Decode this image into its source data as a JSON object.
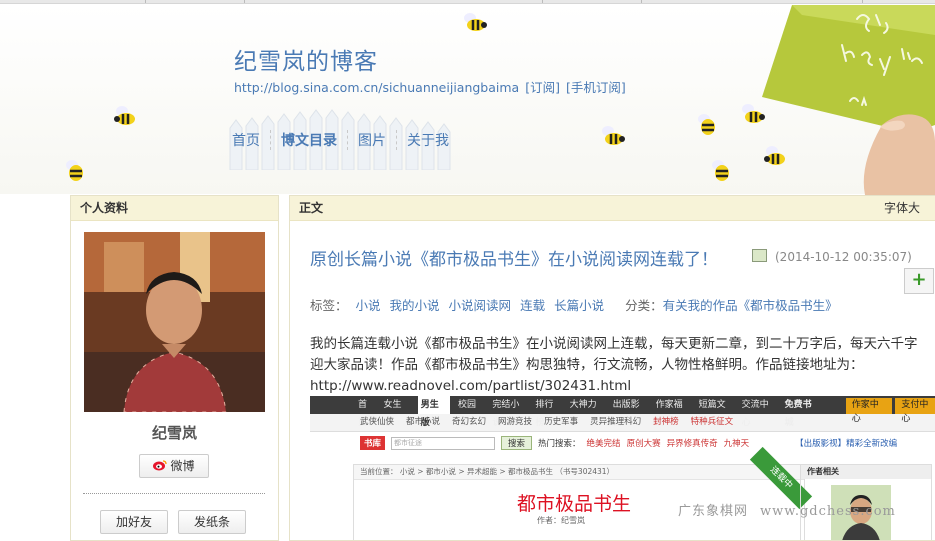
{
  "blog": {
    "title": "纪雪岚的博客",
    "url": "http://blog.sina.com.cn/sichuanneijiangbaima",
    "subscribe": "[订阅]",
    "mobile_subscribe": "[手机订阅]"
  },
  "nav": [
    {
      "label": "首页",
      "active": false
    },
    {
      "label": "博文目录",
      "active": true
    },
    {
      "label": "图片",
      "active": false
    },
    {
      "label": "关于我",
      "active": false
    }
  ],
  "sidebar": {
    "heading": "个人资料",
    "username": "纪雪岚",
    "weibo_label": "微博",
    "add_friend": "加好友",
    "send_note": "发纸条"
  },
  "main": {
    "heading": "正文",
    "font_size_label": "字体大",
    "post_title": "原创长篇小说《都市极品书生》在小说阅读网连载了！",
    "post_date": "(2014-10-12 00:35:07)",
    "plus_label": "+",
    "tags_label": "标签：",
    "tags": [
      "小说",
      "我的小说",
      "小说阅读网",
      "连载",
      "长篇小说"
    ],
    "category_label": "分类：",
    "category": "有关我的作品《都市极品书生》",
    "body_lines": [
      "我的长篇连载小说《都市极品书生》在小说阅读网上连载，每天更新二章，到二十万字后，每天六千字",
      "迎大家品读！作品《都市极品书生》构思独特，行文流畅，人物性格鲜明。作品链接地址为：",
      "http://www.readnovel.com/partlist/302431.html"
    ]
  },
  "embedded": {
    "nav_items": [
      "首页",
      "女生版",
      "男生版",
      "校园版",
      "完结小说",
      "排行榜",
      "大神力作",
      "出版影视",
      "作家福利",
      "短篇文学",
      "交流中心",
      "免费书城"
    ],
    "nav_active": "男生版",
    "nav_buttons": [
      "作家中心",
      "支付中心"
    ],
    "sub_items": [
      "武侠仙侠",
      "都市小说",
      "奇幻玄幻",
      "网游竞技",
      "历史军事",
      "灵异推理科幻",
      "封神榜",
      "特种兵征文"
    ],
    "logo": "书库",
    "search_placeholder": "都市征途",
    "search_button": "搜索",
    "hot_label": "热门搜索：",
    "hot_items": [
      "绝美完结",
      "原创大赛",
      "异界修真传奇",
      "九神天"
    ],
    "right_link": "【出版影视】精彩全新改编",
    "crumb": "当前位置：  小说  >  都市小说  >  异术超能  >  都市极品书生 （书号302431）",
    "book_title": "都市极品书生",
    "author": "作者：纪雪岚",
    "ribbon": "连载中",
    "side_heading": "作者相关"
  },
  "watermark": {
    "text": "广东象棋网",
    "url": "www.gdchess.com"
  }
}
